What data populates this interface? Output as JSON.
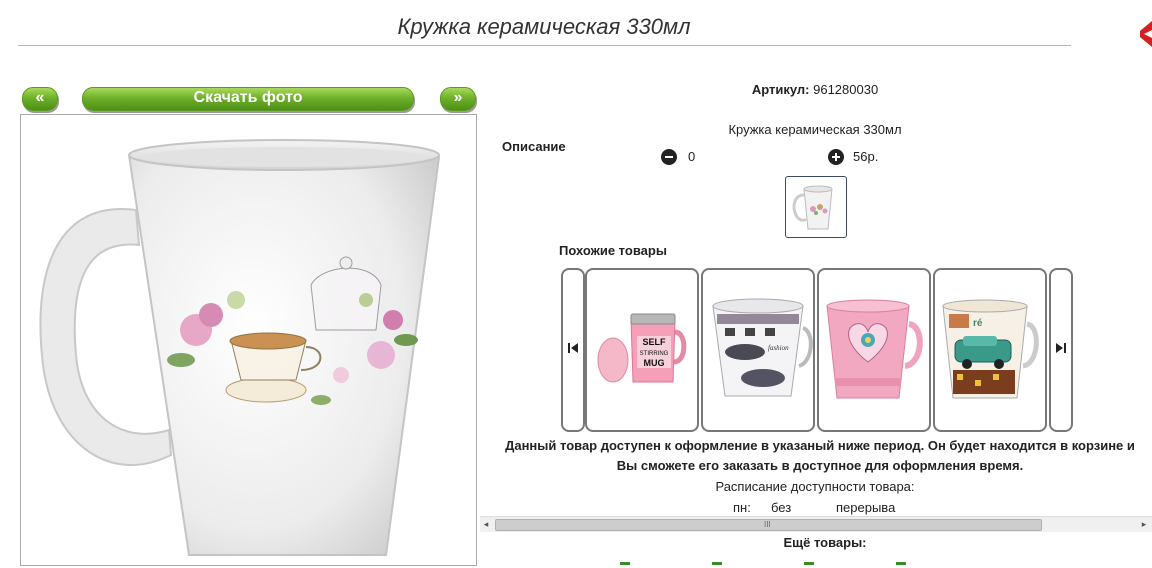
{
  "header": {
    "title": "Кружка керамическая 330мл"
  },
  "nav": {
    "prev_label": "«",
    "download_label": "Скачать фото",
    "next_label": "»"
  },
  "product": {
    "sku_label": "Артикул:",
    "sku_value": "961280030",
    "description_label": "Описание",
    "description_text": "Кружка керамическая 330мл",
    "quantity": "0",
    "price": "56р."
  },
  "similar": {
    "label": "Похожие товары",
    "items": [
      {
        "name": "self-stirring-mug"
      },
      {
        "name": "fashion-mug"
      },
      {
        "name": "pink-heart-mug"
      },
      {
        "name": "retro-car-mug"
      }
    ]
  },
  "availability": {
    "notice": "Данный товар доступен к оформление в указаный ниже период. Он будет находится в корзине и Вы сможете его заказать в доступное для оформления время.",
    "schedule_title": "Расписание доступности товара:",
    "day": "пн:",
    "from": "без",
    "to": "перерыва"
  },
  "scrollbar": {
    "left_arrow": "◂",
    "right_arrow": "▸",
    "grip": "III"
  },
  "more": {
    "label": "Ещё товары:"
  },
  "colors": {
    "accent_green": "#6fb12a",
    "corner_red": "#d42020",
    "link_green": "#3a8a2a"
  },
  "icons": {
    "minus": "minus-circle-icon",
    "plus": "plus-circle-icon",
    "prev_arrow": "skip-prev-icon",
    "next_arrow": "skip-next-icon",
    "close": "close-icon"
  }
}
